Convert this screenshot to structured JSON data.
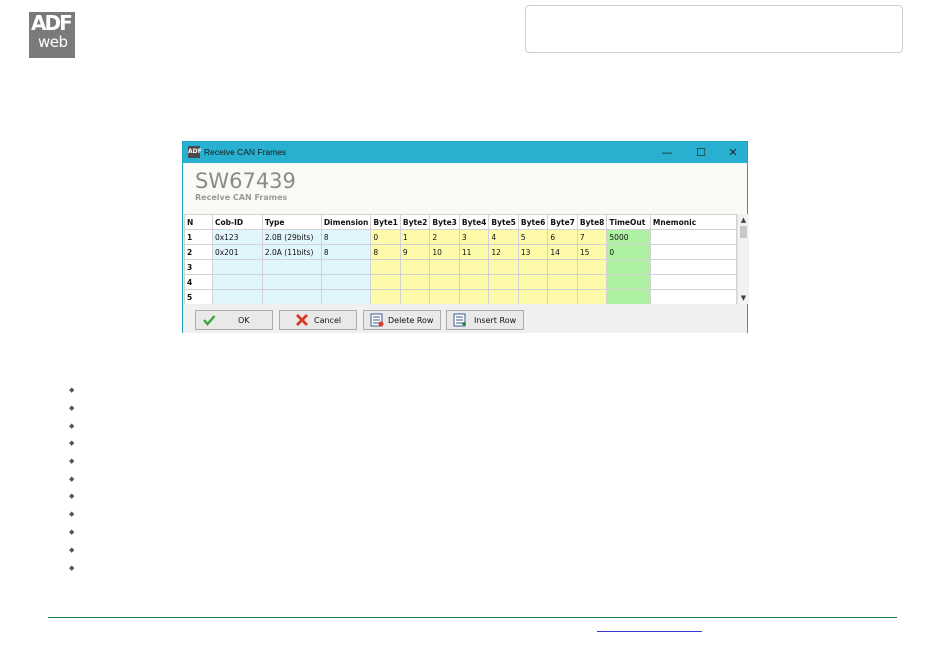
{
  "logo": {
    "line1": "ADF",
    "line2": "web"
  },
  "window": {
    "title": "Receive CAN Frames",
    "app_icon": "ADF",
    "controls": {
      "minimize": "—",
      "maximize": "☐",
      "close": "✕"
    },
    "heading": "SW67439",
    "subheading": "Receive CAN Frames"
  },
  "grid": {
    "columns": [
      "N",
      "Cob-ID",
      "Type",
      "Dimension",
      "Byte1",
      "Byte2",
      "Byte3",
      "Byte4",
      "Byte5",
      "Byte6",
      "Byte7",
      "Byte8",
      "TimeOut",
      "Mnemonic"
    ],
    "rows": [
      [
        "1",
        "0x123",
        "2.0B (29bits)",
        "8",
        "0",
        "1",
        "2",
        "3",
        "4",
        "5",
        "6",
        "7",
        "5000",
        ""
      ],
      [
        "2",
        "0x201",
        "2.0A (11bits)",
        "8",
        "8",
        "9",
        "10",
        "11",
        "12",
        "13",
        "14",
        "15",
        "0",
        ""
      ],
      [
        "3",
        "",
        "",
        "",
        "",
        "",
        "",
        "",
        "",
        "",
        "",
        "",
        "",
        ""
      ],
      [
        "4",
        "",
        "",
        "",
        "",
        "",
        "",
        "",
        "",
        "",
        "",
        "",
        "",
        ""
      ],
      [
        "5",
        "",
        "",
        "",
        "",
        "",
        "",
        "",
        "",
        "",
        "",
        "",
        "",
        ""
      ]
    ],
    "colors": {
      "cyan": "#e1f6fc",
      "yellow": "#fdfbaa",
      "green": "#aef1a3"
    }
  },
  "scrollbar": {
    "up": "▲",
    "down": "▼"
  },
  "buttons": {
    "ok": {
      "label": "OK",
      "icon": "checkmark-icon"
    },
    "cancel": {
      "label": "Cancel",
      "icon": "cancel-x-icon"
    },
    "delete_row": {
      "label": "Delete Row",
      "icon": "delete-row-icon"
    },
    "insert_row": {
      "label": "Insert Row",
      "icon": "insert-row-icon"
    }
  },
  "bullets": {
    "count": 11,
    "glyph": "◆"
  }
}
